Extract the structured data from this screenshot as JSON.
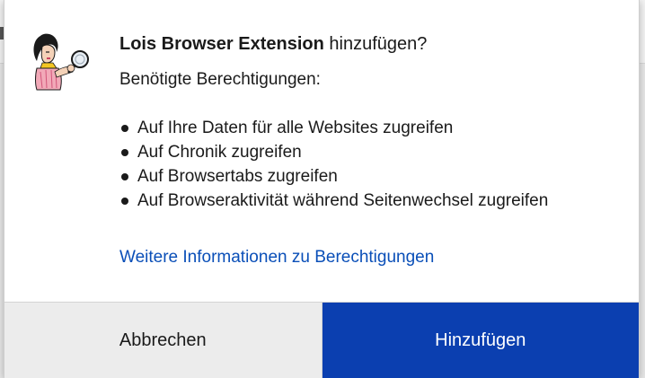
{
  "dialog": {
    "title_name": "Lois Browser Extension",
    "title_suffix": " hinzufügen?",
    "subtitle": "Benötigte Berechtigungen:",
    "permissions": [
      "Auf Ihre Daten für alle Websites zugreifen",
      "Auf Chronik zugreifen",
      "Auf Browsertabs zugreifen",
      "Auf Browseraktivität während Seitenwechsel zugreifen"
    ],
    "info_link": "Weitere Informationen zu Berechtigungen",
    "cancel_label": "Abbrechen",
    "add_label": "Hinzufügen",
    "icon": "extension-mascot-icon"
  },
  "colors": {
    "link": "#0a4fb8",
    "primary_button": "#0b3fb0",
    "secondary_button": "#ececec"
  }
}
